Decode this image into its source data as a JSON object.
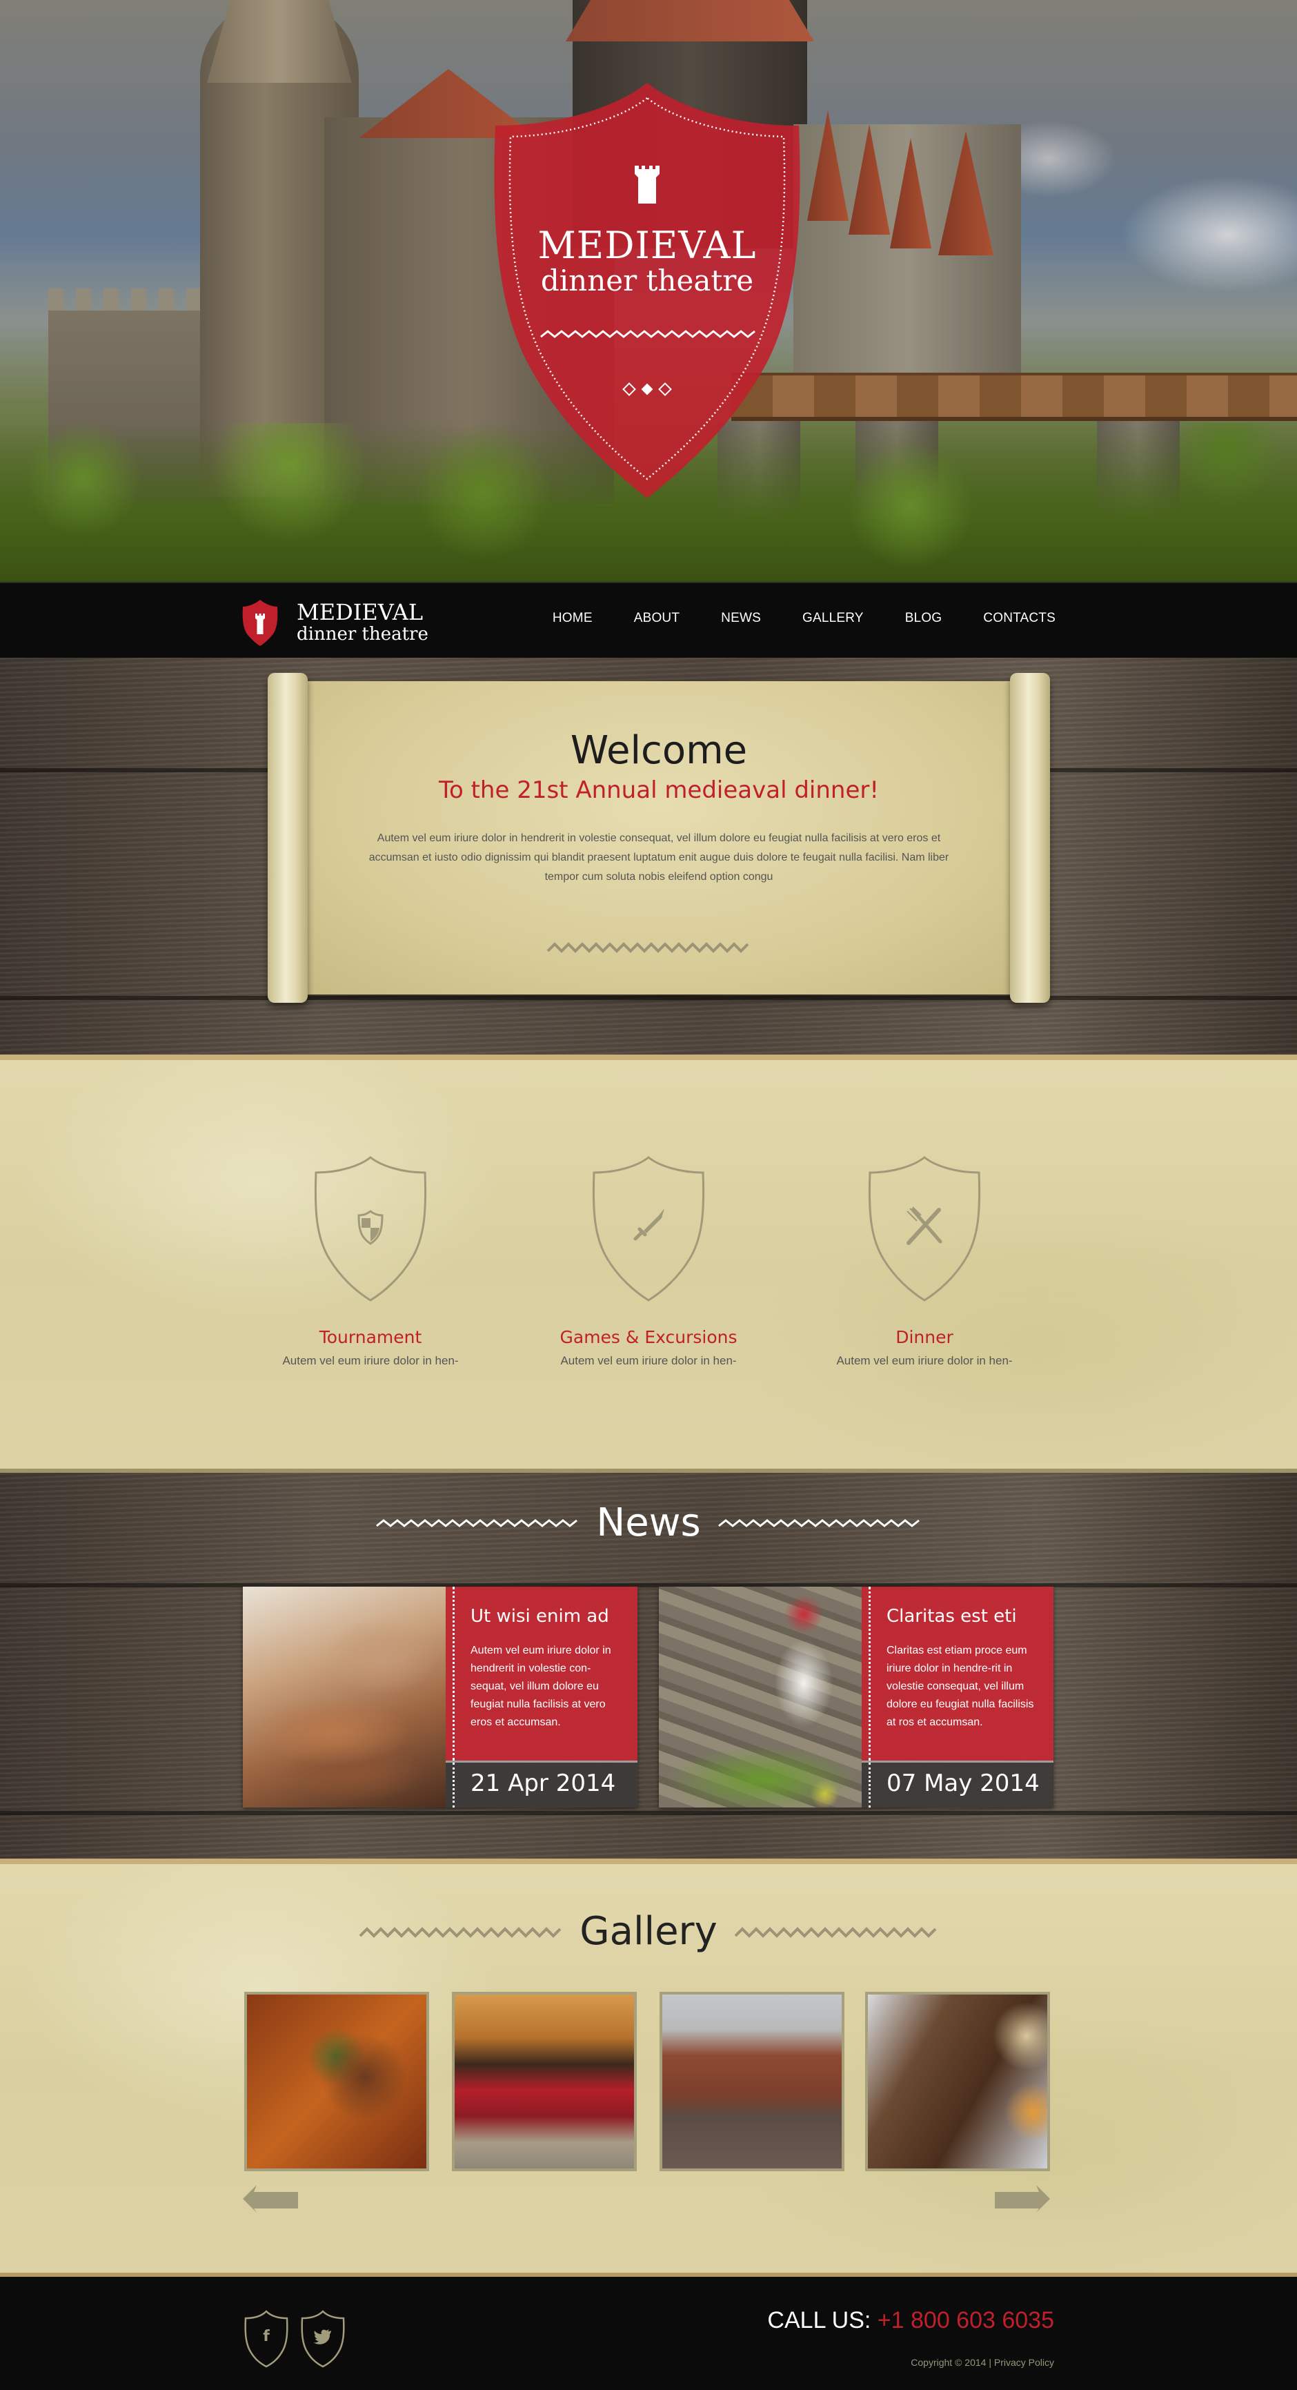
{
  "hero": {
    "brand_line1": "MEDIEVAL",
    "brand_line2": "dinner theatre",
    "slider_dots": 3,
    "active_dot": 2
  },
  "nav": {
    "logo_line1": "MEDIEVAL",
    "logo_line2": "dinner theatre",
    "items": [
      {
        "label": "HOME"
      },
      {
        "label": "ABOUT"
      },
      {
        "label": "NEWS"
      },
      {
        "label": "GALLERY"
      },
      {
        "label": "BLOG"
      },
      {
        "label": "CONTACTS"
      }
    ]
  },
  "welcome": {
    "title": "Welcome",
    "subtitle": "To the 21st Annual medieaval dinner!",
    "body": "Autem vel eum iriure dolor in hendrerit in volestie consequat, vel illum dolore eu feugiat nulla facilisis at vero eros et accumsan et iusto odio dignissim qui blandit praesent luptatum enit augue duis dolore te feugait nulla facilisi. Nam liber tempor cum soluta nobis eleifend option congu"
  },
  "features": [
    {
      "icon": "heraldic-shield-icon",
      "title": "Tournament",
      "text": "Autem vel eum iriure dolor in hen-"
    },
    {
      "icon": "sword-icon",
      "title": "Games & Excursions",
      "text": "Autem vel eum iriure dolor in hen-"
    },
    {
      "icon": "fork-knife-icon",
      "title": "Dinner",
      "text": "Autem vel eum iriure dolor in hen-"
    }
  ],
  "news": {
    "title": "News",
    "items": [
      {
        "title": "Ut wisi enim ad",
        "body": "Autem vel eum iriure dolor in hendrerit in volestie con-sequat, vel illum dolore eu feugiat nulla facilisis at vero eros et accumsan.",
        "date": "21 Apr 2014"
      },
      {
        "title": "Claritas est eti",
        "body": "Claritas est etiam proce eum iriure dolor in hendre-rit in volestie consequat, vel illum dolore eu feugiat nulla facilisis at ros et accumsan.",
        "date": "07 May 2014"
      }
    ]
  },
  "gallery": {
    "title": "Gallery",
    "prev_label": "previous",
    "next_label": "next"
  },
  "footer": {
    "social": [
      {
        "icon": "facebook-icon",
        "glyph": "f"
      },
      {
        "icon": "twitter-icon",
        "glyph": "t"
      }
    ],
    "call_label": "CALL US:",
    "phone": "+1 800 603 6035",
    "copyright": "Copyright © 2014 |",
    "privacy": "Privacy Policy"
  },
  "colors": {
    "accent_red": "#c0202c",
    "dark": "#0b0b0b",
    "parchment": "#dcd2a5",
    "olive_icon": "#a29c7c"
  }
}
